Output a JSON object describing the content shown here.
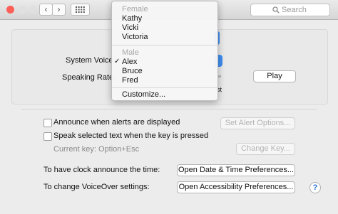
{
  "titlebar": {
    "back": "‹",
    "forward": "›",
    "search_placeholder": "Search"
  },
  "colors": {
    "close": "#fc5f57",
    "minimize": "#e0e0e0",
    "zoom": "#e0e0e0",
    "accent": "#2a74d8"
  },
  "voice": {
    "system_voice_label": "System Voice:",
    "speaking_rate_label": "Speaking Rate:",
    "play_label": "Play",
    "partial_text": "st"
  },
  "menu": {
    "female_header": "Female",
    "female": [
      "Kathy",
      "Vicki",
      "Victoria"
    ],
    "male_header": "Male",
    "male": [
      "Alex",
      "Bruce",
      "Fred"
    ],
    "checkmark": "✓",
    "customize": "Customize..."
  },
  "alerts": {
    "announce_label": "Announce when alerts are displayed",
    "set_alert_options": "Set Alert Options...",
    "speak_selected_label": "Speak selected text when the key is pressed",
    "current_key": "Current key: Option+Esc",
    "change_key": "Change Key..."
  },
  "clock": {
    "label": "To have clock announce the time:",
    "button": "Open Date & Time Preferences..."
  },
  "voiceover": {
    "label": "To change VoiceOver settings:",
    "button": "Open Accessibility Preferences..."
  },
  "help": "?"
}
